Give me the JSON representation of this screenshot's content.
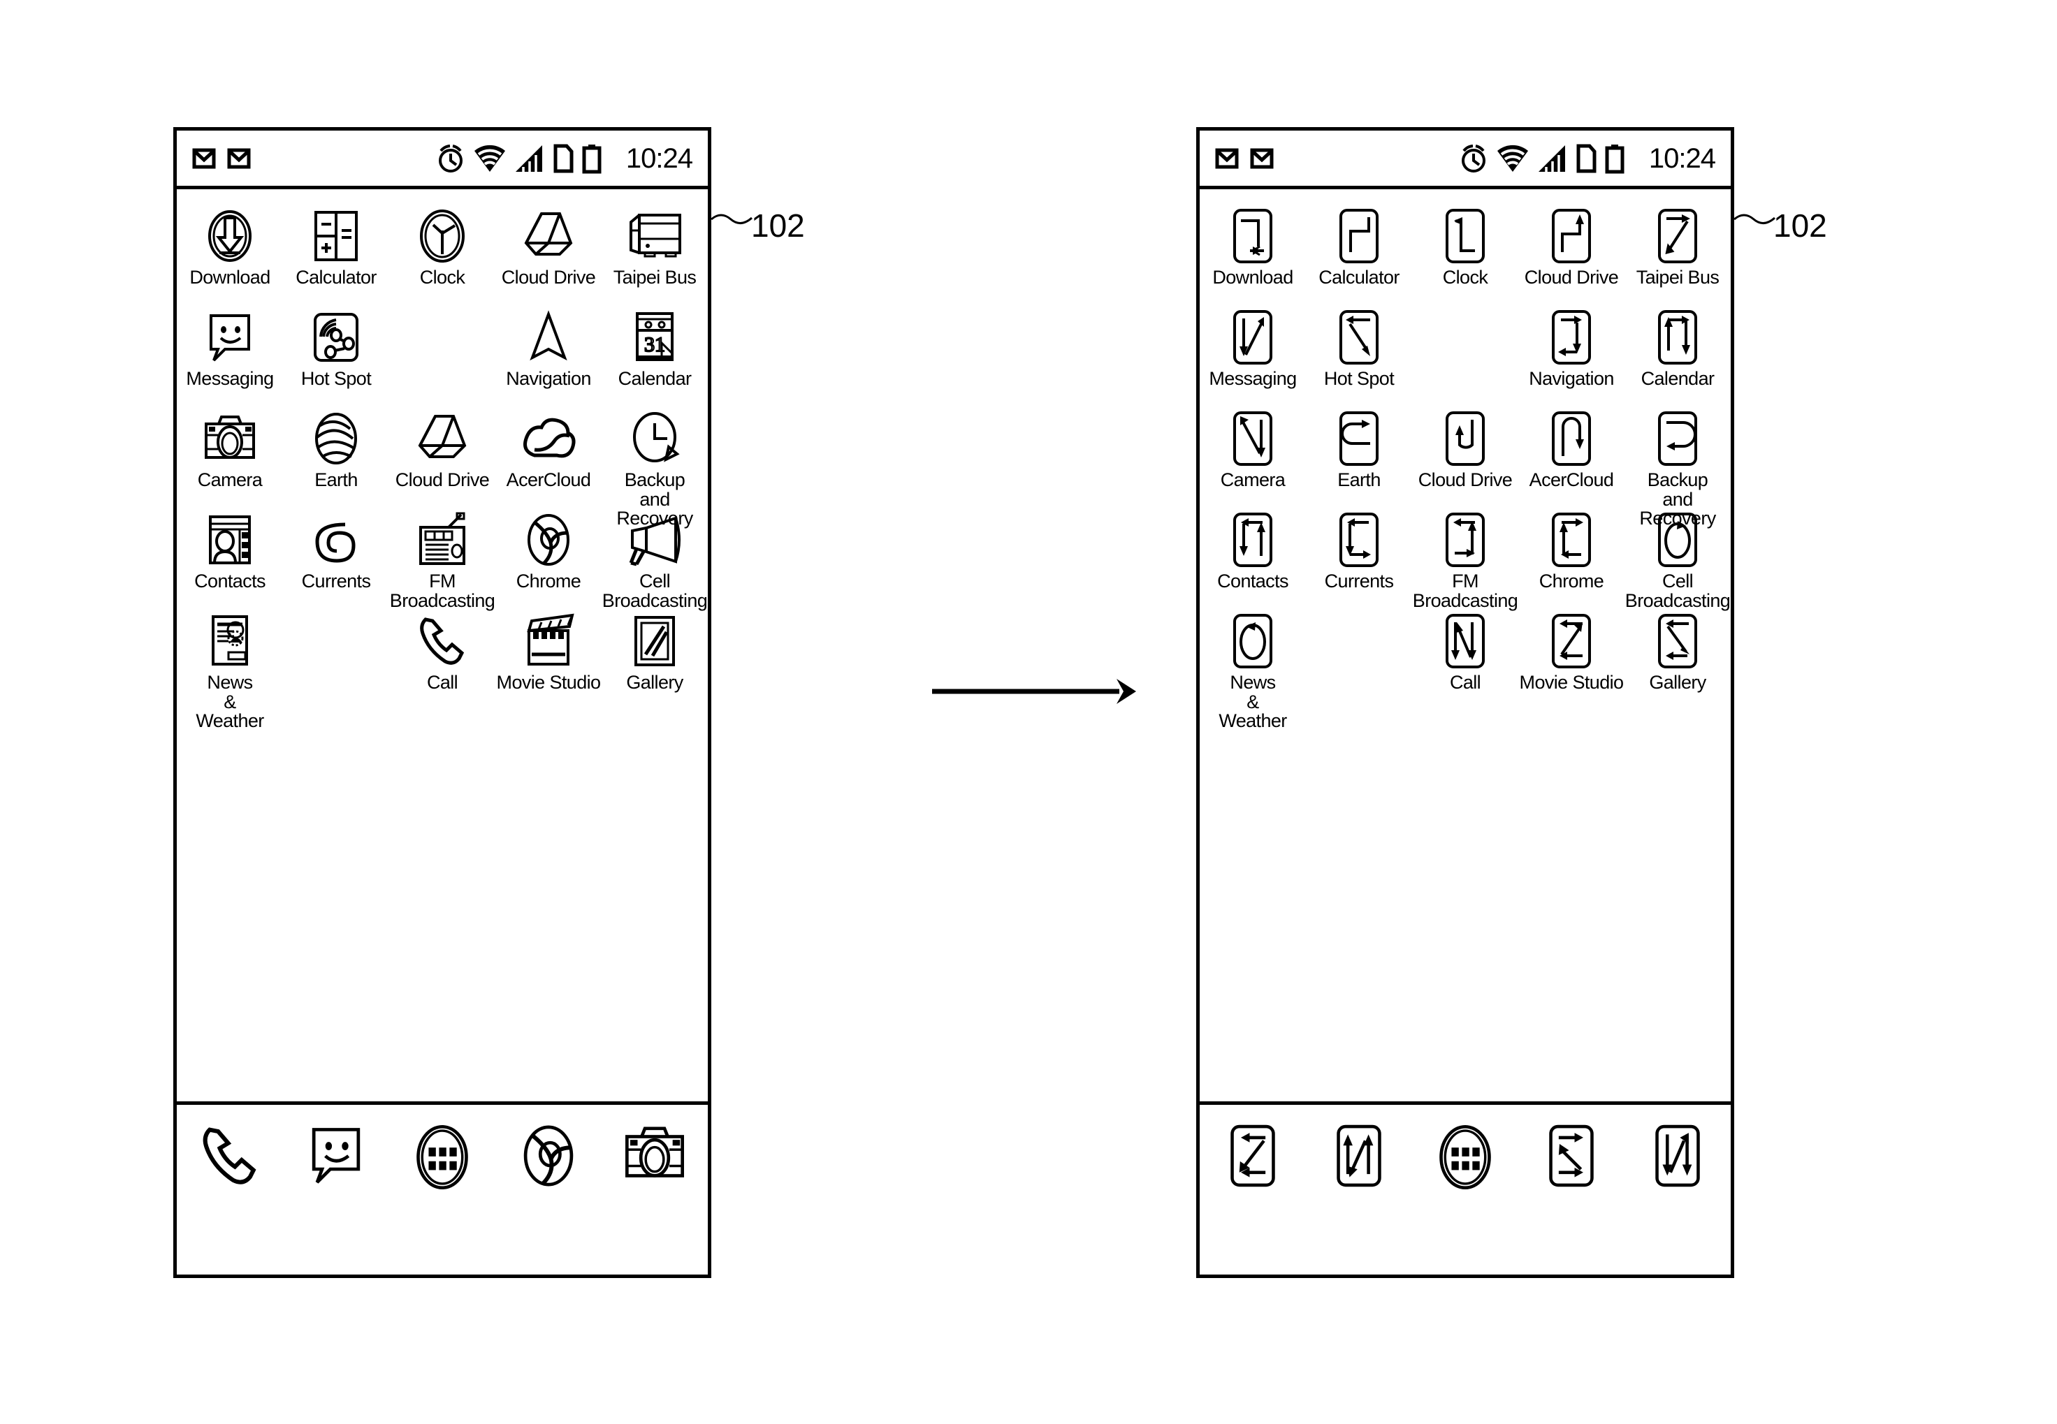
{
  "figure": {
    "reference_numeral": "102",
    "transition_arrow": "rightwards-arrow"
  },
  "status_bar": {
    "clock": "10:24",
    "left_icons": [
      "envelope-icon",
      "envelope-icon"
    ],
    "right_icons": [
      "alarm-clock-icon",
      "wifi-icon",
      "signal-bars-icon",
      "sim-card-icon",
      "battery-icon"
    ]
  },
  "before_screen": {
    "rows": [
      [
        {
          "label": "Download",
          "icon": "download-icon"
        },
        {
          "label": "Calculator",
          "icon": "calculator-icon"
        },
        {
          "label": "Clock",
          "icon": "clock-icon"
        },
        {
          "label": "Cloud Drive",
          "icon": "cloud-drive-icon"
        },
        {
          "label": "Taipei Bus",
          "icon": "bus-icon"
        }
      ],
      [
        {
          "label": "Messaging",
          "icon": "message-bubble-icon"
        },
        {
          "label": "Hot Spot",
          "icon": "hotspot-icon"
        },
        {
          "label": "",
          "icon": ""
        },
        {
          "label": "Navigation",
          "icon": "navigation-arrow-icon"
        },
        {
          "label": "Calendar",
          "icon": "calendar-icon"
        }
      ],
      [
        {
          "label": "Camera",
          "icon": "camera-icon"
        },
        {
          "label": "Earth",
          "icon": "earth-globe-icon"
        },
        {
          "label": "Cloud Drive",
          "icon": "cloud-drive-icon"
        },
        {
          "label": "AcerCloud",
          "icon": "cloud-icon"
        },
        {
          "label": "Backup\nand\nRecovery",
          "icon": "backup-recovery-icon"
        }
      ],
      [
        {
          "label": "Contacts",
          "icon": "contacts-icon"
        },
        {
          "label": "Currents",
          "icon": "currents-spiral-icon"
        },
        {
          "label": "FM\nBroadcasting",
          "icon": "radio-icon"
        },
        {
          "label": "Chrome",
          "icon": "chrome-icon"
        },
        {
          "label": "Cell\nBroadcasting",
          "icon": "megaphone-icon"
        }
      ],
      [
        {
          "label": "News\n&\nWeather",
          "icon": "news-weather-icon"
        },
        {
          "label": "",
          "icon": ""
        },
        {
          "label": "Call",
          "icon": "phone-handset-icon"
        },
        {
          "label": "Movie Studio",
          "icon": "clapperboard-icon"
        },
        {
          "label": "Gallery",
          "icon": "gallery-icon"
        }
      ]
    ],
    "dock": [
      {
        "icon": "phone-handset-icon"
      },
      {
        "icon": "message-bubble-icon"
      },
      {
        "icon": "app-drawer-icon"
      },
      {
        "icon": "chrome-icon"
      },
      {
        "icon": "camera-icon"
      }
    ]
  },
  "after_screen": {
    "rows": [
      [
        {
          "label": "Download",
          "icon": "stroke-path-icon"
        },
        {
          "label": "Calculator",
          "icon": "stroke-path-icon"
        },
        {
          "label": "Clock",
          "icon": "stroke-path-icon"
        },
        {
          "label": "Cloud Drive",
          "icon": "stroke-path-icon"
        },
        {
          "label": "Taipei Bus",
          "icon": "stroke-path-icon"
        }
      ],
      [
        {
          "label": "Messaging",
          "icon": "stroke-path-icon"
        },
        {
          "label": "Hot Spot",
          "icon": "stroke-path-icon"
        },
        {
          "label": "",
          "icon": ""
        },
        {
          "label": "Navigation",
          "icon": "stroke-path-icon"
        },
        {
          "label": "Calendar",
          "icon": "stroke-path-icon"
        }
      ],
      [
        {
          "label": "Camera",
          "icon": "stroke-path-icon"
        },
        {
          "label": "Earth",
          "icon": "stroke-path-icon"
        },
        {
          "label": "Cloud Drive",
          "icon": "stroke-path-icon"
        },
        {
          "label": "AcerCloud",
          "icon": "stroke-path-icon"
        },
        {
          "label": "Backup\nand\nRecovery",
          "icon": "stroke-path-icon"
        }
      ],
      [
        {
          "label": "Contacts",
          "icon": "stroke-path-icon"
        },
        {
          "label": "Currents",
          "icon": "stroke-path-icon"
        },
        {
          "label": "FM\nBroadcasting",
          "icon": "stroke-path-icon"
        },
        {
          "label": "Chrome",
          "icon": "stroke-path-icon"
        },
        {
          "label": "Cell\nBroadcasting",
          "icon": "stroke-path-icon"
        }
      ],
      [
        {
          "label": "News\n&\nWeather",
          "icon": "stroke-path-icon"
        },
        {
          "label": "",
          "icon": ""
        },
        {
          "label": "Call",
          "icon": "stroke-path-icon"
        },
        {
          "label": "Movie Studio",
          "icon": "stroke-path-icon"
        },
        {
          "label": "Gallery",
          "icon": "stroke-path-icon"
        }
      ]
    ],
    "dock": [
      {
        "icon": "stroke-path-icon"
      },
      {
        "icon": "stroke-path-icon"
      },
      {
        "icon": "app-drawer-icon"
      },
      {
        "icon": "stroke-path-icon"
      },
      {
        "icon": "stroke-path-icon"
      }
    ]
  }
}
